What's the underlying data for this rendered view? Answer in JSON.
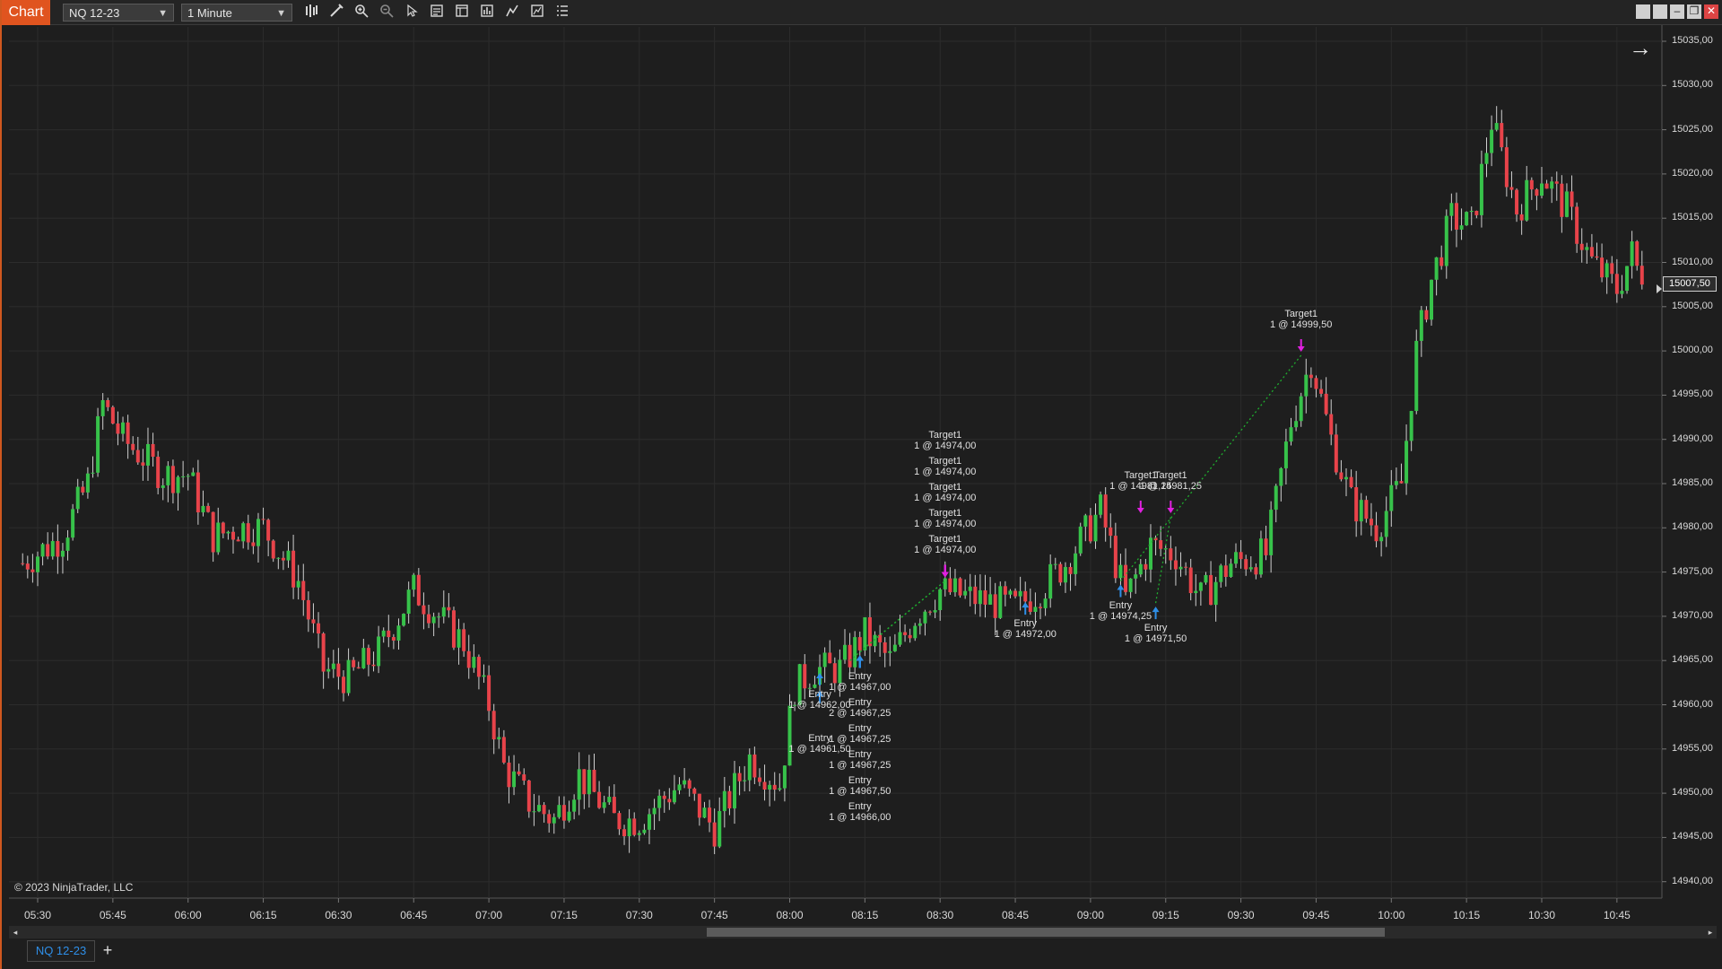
{
  "window": {
    "title": "Chart"
  },
  "toolbar": {
    "instrument": "NQ 12-23",
    "interval": "1 Minute",
    "icons": [
      "bar-type-icon",
      "drawing-tool-icon",
      "zoom-in-icon",
      "zoom-out-icon",
      "pointer-icon",
      "data-box-icon",
      "chart-trader-icon",
      "strategies-icon",
      "indicators-icon",
      "properties-icon",
      "object-list-icon"
    ]
  },
  "window_controls": [
    "tile-icon",
    "tile-icon",
    "minimize-icon",
    "restore-icon",
    "close-icon"
  ],
  "chart": {
    "copyright": "© 2023 NinjaTrader, LLC",
    "last_price": "15007,50",
    "colors": {
      "up": "#37c24a",
      "down": "#e8434a",
      "grid": "#2c2c2c",
      "background": "#1e1e1e"
    }
  },
  "chart_data": {
    "type": "candlestick",
    "instrument": "NQ 12-23",
    "interval": "1 Minute",
    "x_ticks": [
      "05:30",
      "05:45",
      "06:00",
      "06:15",
      "06:30",
      "06:45",
      "07:00",
      "07:15",
      "07:30",
      "07:45",
      "08:00",
      "08:15",
      "08:30",
      "08:45",
      "09:00",
      "09:15",
      "09:30",
      "09:45",
      "10:00",
      "10:15",
      "10:30",
      "10:45"
    ],
    "y_ticks": [
      "15035,00",
      "15030,00",
      "15025,00",
      "15020,00",
      "15015,00",
      "15010,00",
      "15005,00",
      "15000,00",
      "14995,00",
      "14990,00",
      "14985,00",
      "14980,00",
      "14975,00",
      "14970,00",
      "14965,00",
      "14960,00",
      "14955,00",
      "14950,00",
      "14945,00",
      "14940,00"
    ],
    "ylim": [
      14940,
      15035
    ],
    "close_path": [
      {
        "t": "05:27",
        "p": 14976
      },
      {
        "t": "05:35",
        "p": 14979
      },
      {
        "t": "05:40",
        "p": 14985
      },
      {
        "t": "05:43",
        "p": 14994
      },
      {
        "t": "05:47",
        "p": 14990
      },
      {
        "t": "05:55",
        "p": 14986
      },
      {
        "t": "06:00",
        "p": 14986
      },
      {
        "t": "06:05",
        "p": 14979
      },
      {
        "t": "06:10",
        "p": 14980
      },
      {
        "t": "06:15",
        "p": 14980
      },
      {
        "t": "06:22",
        "p": 14974
      },
      {
        "t": "06:27",
        "p": 14964
      },
      {
        "t": "06:32",
        "p": 14963
      },
      {
        "t": "06:38",
        "p": 14966
      },
      {
        "t": "06:45",
        "p": 14973
      },
      {
        "t": "06:50",
        "p": 14970
      },
      {
        "t": "06:55",
        "p": 14967
      },
      {
        "t": "07:00",
        "p": 14960
      },
      {
        "t": "07:03",
        "p": 14953
      },
      {
        "t": "07:08",
        "p": 14949
      },
      {
        "t": "07:13",
        "p": 14947
      },
      {
        "t": "07:18",
        "p": 14952
      },
      {
        "t": "07:25",
        "p": 14947
      },
      {
        "t": "07:30",
        "p": 14947
      },
      {
        "t": "07:38",
        "p": 14951
      },
      {
        "t": "07:45",
        "p": 14946
      },
      {
        "t": "07:52",
        "p": 14954
      },
      {
        "t": "07:58",
        "p": 14951
      },
      {
        "t": "08:01",
        "p": 14962
      },
      {
        "t": "08:05",
        "p": 14964
      },
      {
        "t": "08:10",
        "p": 14964
      },
      {
        "t": "08:15",
        "p": 14968
      },
      {
        "t": "08:20",
        "p": 14965
      },
      {
        "t": "08:25",
        "p": 14970
      },
      {
        "t": "08:30",
        "p": 14973
      },
      {
        "t": "08:37",
        "p": 14972
      },
      {
        "t": "08:45",
        "p": 14971
      },
      {
        "t": "08:50",
        "p": 14973
      },
      {
        "t": "08:55",
        "p": 14976
      },
      {
        "t": "09:02",
        "p": 14982
      },
      {
        "t": "09:07",
        "p": 14972
      },
      {
        "t": "09:12",
        "p": 14978
      },
      {
        "t": "09:17",
        "p": 14977
      },
      {
        "t": "09:22",
        "p": 14972
      },
      {
        "t": "09:28",
        "p": 14976
      },
      {
        "t": "09:35",
        "p": 14977
      },
      {
        "t": "09:40",
        "p": 14992
      },
      {
        "t": "09:44",
        "p": 14999
      },
      {
        "t": "09:48",
        "p": 14990
      },
      {
        "t": "09:52",
        "p": 14983
      },
      {
        "t": "09:57",
        "p": 14980
      },
      {
        "t": "10:02",
        "p": 14985
      },
      {
        "t": "10:05",
        "p": 15000
      },
      {
        "t": "10:08",
        "p": 15008
      },
      {
        "t": "10:12",
        "p": 15015
      },
      {
        "t": "10:16",
        "p": 15014
      },
      {
        "t": "10:20",
        "p": 15026
      },
      {
        "t": "10:25",
        "p": 15016
      },
      {
        "t": "10:30",
        "p": 15020
      },
      {
        "t": "10:35",
        "p": 15016
      },
      {
        "t": "10:40",
        "p": 15010
      },
      {
        "t": "10:45",
        "p": 15007
      },
      {
        "t": "10:48",
        "p": 15011
      },
      {
        "t": "10:50",
        "p": 15007.5
      }
    ],
    "executions": [
      {
        "kind": "Entry",
        "detail": "1 @ 14962,00",
        "t": "08:06",
        "p": 14964
      },
      {
        "kind": "Entry",
        "detail": "1 @ 14961,50",
        "t": "08:06",
        "p": 14962
      },
      {
        "kind": "Entry",
        "detail": "1 @ 14967,00",
        "t": "08:14",
        "p": 14966
      },
      {
        "kind": "Entry",
        "detail": "2 @ 14967,25",
        "t": "08:14",
        "p": 14966
      },
      {
        "kind": "Entry",
        "detail": "1 @ 14967,25",
        "t": "08:14",
        "p": 14966
      },
      {
        "kind": "Entry",
        "detail": "1 @ 14967,25",
        "t": "08:14",
        "p": 14966
      },
      {
        "kind": "Entry",
        "detail": "1 @ 14967,50",
        "t": "08:14",
        "p": 14966
      },
      {
        "kind": "Entry",
        "detail": "1 @ 14966,00",
        "t": "08:14",
        "p": 14966
      },
      {
        "kind": "Target1",
        "detail": "1 @ 14974,00",
        "t": "08:31",
        "p": 14974
      },
      {
        "kind": "Target1",
        "detail": "1 @ 14974,00",
        "t": "08:31",
        "p": 14974
      },
      {
        "kind": "Target1",
        "detail": "1 @ 14974,00",
        "t": "08:31",
        "p": 14974
      },
      {
        "kind": "Target1",
        "detail": "1 @ 14974,00",
        "t": "08:31",
        "p": 14974
      },
      {
        "kind": "Target1",
        "detail": "1 @ 14974,00",
        "t": "08:31",
        "p": 14974
      },
      {
        "kind": "Entry",
        "detail": "1 @ 14972,00",
        "t": "08:47",
        "p": 14972
      },
      {
        "kind": "Entry",
        "detail": "1 @ 14974,25",
        "t": "09:06",
        "p": 14974
      },
      {
        "kind": "Target1",
        "detail": "1 @ 14981,25",
        "t": "09:10",
        "p": 14981.25
      },
      {
        "kind": "Entry",
        "detail": "1 @ 14971,50",
        "t": "09:13",
        "p": 14971.5
      },
      {
        "kind": "Target1",
        "detail": "1 @ 14981,25",
        "t": "09:16",
        "p": 14981.25
      },
      {
        "kind": "Target1",
        "detail": "1 @ 14999,50",
        "t": "09:42",
        "p": 14999.5
      }
    ]
  },
  "scrollbar": {
    "left": "◂",
    "right": "▸"
  },
  "tabs": {
    "instrument_tab": "NQ 12-23",
    "add_label": "+"
  }
}
